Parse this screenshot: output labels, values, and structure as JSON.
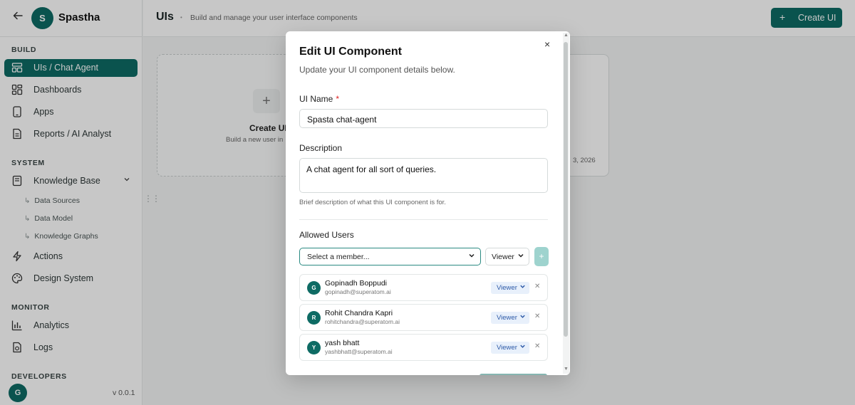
{
  "brand": {
    "back_icon": "arrow-left-icon",
    "logo_letter": "S",
    "name": "Spastha"
  },
  "sidebar": {
    "section_build": "BUILD",
    "section_system": "SYSTEM",
    "section_monitor": "MONITOR",
    "section_developers": "DEVELOPERS",
    "items": [
      {
        "label": "UIs / Chat Agent",
        "icon": "layout-icon",
        "active": true
      },
      {
        "label": "Dashboards",
        "icon": "grid-icon"
      },
      {
        "label": "Apps",
        "icon": "phone-icon"
      },
      {
        "label": "Reports / AI Analyst",
        "icon": "document-icon"
      },
      {
        "label": "Knowledge Base",
        "icon": "book-icon"
      },
      {
        "label": "Actions",
        "icon": "lightning-icon"
      },
      {
        "label": "Design System",
        "icon": "palette-icon"
      },
      {
        "label": "Analytics",
        "icon": "bar-chart-icon"
      },
      {
        "label": "Logs",
        "icon": "log-file-icon"
      }
    ],
    "subitems": [
      "Data Sources",
      "Data Model",
      "Knowledge Graphs"
    ],
    "footer": {
      "avatar_letter": "G",
      "version": "v 0.0.1"
    }
  },
  "header": {
    "title": "UIs",
    "subtitle": "Build and manage your user interface components",
    "create_button": "Create UI"
  },
  "cards": {
    "new_title": "Create UI",
    "new_subtitle": "Build a new user in",
    "existing_date": "3, 2026"
  },
  "modal": {
    "title": "Edit UI Component",
    "subtitle": "Update your UI component details below.",
    "ui_name_label": "UI Name",
    "required_mark": "*",
    "ui_name_value": "Spasta chat-agent",
    "description_label": "Description",
    "description_value": "A chat agent for all sort of queries.",
    "description_hint": "Brief description of what this UI component is for.",
    "allowed_users_label": "Allowed Users",
    "member_select_placeholder": "Select a member...",
    "role_select_value": "Viewer",
    "add_button": "+",
    "close": "×",
    "users": [
      {
        "initial": "G",
        "name": "Gopinadh Boppudi",
        "email": "gopinadh@superatom.ai",
        "role": "Viewer"
      },
      {
        "initial": "R",
        "name": "Rohit Chandra Kapri",
        "email": "rohitchandra@superatom.ai",
        "role": "Viewer"
      },
      {
        "initial": "Y",
        "name": "yash bhatt",
        "email": "yashbhatt@superatom.ai",
        "role": "Viewer"
      }
    ]
  }
}
